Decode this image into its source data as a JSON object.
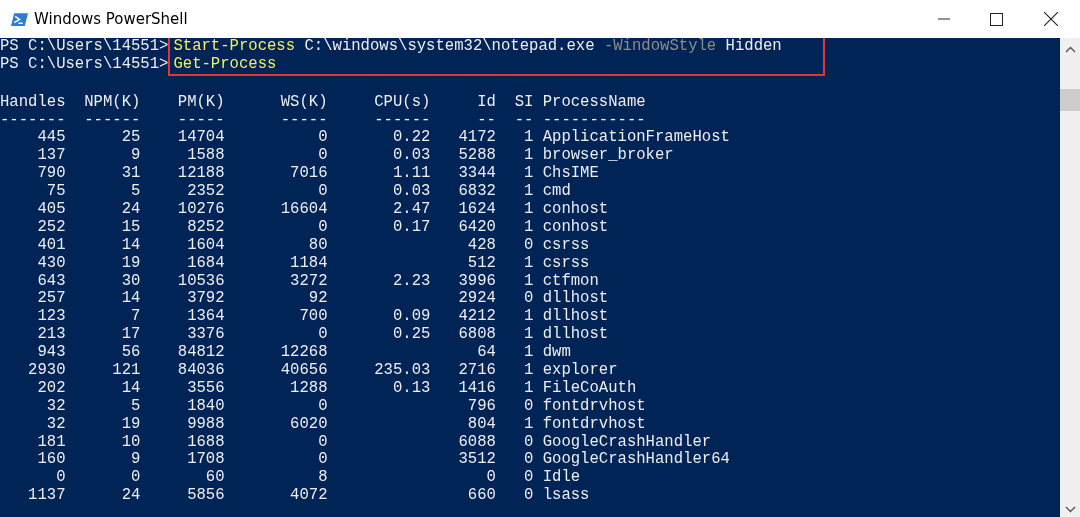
{
  "window": {
    "title": "Windows PowerShell"
  },
  "console": {
    "commands": [
      {
        "prompt": "PS C:\\Users\\14551>",
        "tokens": [
          {
            "kind": "cmdlet",
            "text": "Start-Process"
          },
          {
            "kind": "argument",
            "text": "C:\\windows\\system32\\notepad.exe"
          },
          {
            "kind": "parameter",
            "text": "-WindowStyle"
          },
          {
            "kind": "argument",
            "text": "Hidden"
          }
        ]
      },
      {
        "prompt": "PS C:\\Users\\14551>",
        "tokens": [
          {
            "kind": "cmdlet",
            "text": "Get-Process"
          }
        ]
      }
    ],
    "highlight_box": true,
    "table": {
      "columns": [
        {
          "heading": "Handles",
          "rule": "-------"
        },
        {
          "heading": "NPM(K)",
          "rule": "------"
        },
        {
          "heading": "PM(K)",
          "rule": "-----"
        },
        {
          "heading": "WS(K)",
          "rule": "-----"
        },
        {
          "heading": "CPU(s)",
          "rule": "------"
        },
        {
          "heading": "Id",
          "rule": "--"
        },
        {
          "heading": "SI",
          "rule": "--"
        },
        {
          "heading": "ProcessName",
          "rule": "-----------"
        }
      ],
      "rows": [
        {
          "cells": [
            "445",
            "25",
            "14704",
            "0",
            "0.22",
            "4172",
            "1",
            "ApplicationFrameHost"
          ]
        },
        {
          "cells": [
            "137",
            "9",
            "1588",
            "0",
            "0.03",
            "5288",
            "1",
            "browser_broker"
          ]
        },
        {
          "cells": [
            "790",
            "31",
            "12188",
            "7016",
            "1.11",
            "3344",
            "1",
            "ChsIME"
          ]
        },
        {
          "cells": [
            "75",
            "5",
            "2352",
            "0",
            "0.03",
            "6832",
            "1",
            "cmd"
          ]
        },
        {
          "cells": [
            "405",
            "24",
            "10276",
            "16604",
            "2.47",
            "1624",
            "1",
            "conhost"
          ]
        },
        {
          "cells": [
            "252",
            "15",
            "8252",
            "0",
            "0.17",
            "6420",
            "1",
            "conhost"
          ]
        },
        {
          "cells": [
            "401",
            "14",
            "1604",
            "80",
            null,
            "428",
            "0",
            "csrss"
          ]
        },
        {
          "cells": [
            "430",
            "19",
            "1684",
            "1184",
            null,
            "512",
            "1",
            "csrss"
          ]
        },
        {
          "cells": [
            "643",
            "30",
            "10536",
            "3272",
            "2.23",
            "3996",
            "1",
            "ctfmon"
          ]
        },
        {
          "cells": [
            "257",
            "14",
            "3792",
            "92",
            null,
            "2924",
            "0",
            "dllhost"
          ]
        },
        {
          "cells": [
            "123",
            "7",
            "1364",
            "700",
            "0.09",
            "4212",
            "1",
            "dllhost"
          ]
        },
        {
          "cells": [
            "213",
            "17",
            "3376",
            "0",
            "0.25",
            "6808",
            "1",
            "dllhost"
          ]
        },
        {
          "cells": [
            "943",
            "56",
            "84812",
            "12268",
            null,
            "64",
            "1",
            "dwm"
          ]
        },
        {
          "cells": [
            "2930",
            "121",
            "84036",
            "40656",
            "235.03",
            "2716",
            "1",
            "explorer"
          ]
        },
        {
          "cells": [
            "202",
            "14",
            "3556",
            "1288",
            "0.13",
            "1416",
            "1",
            "FileCoAuth"
          ]
        },
        {
          "cells": [
            "32",
            "5",
            "1840",
            "0",
            null,
            "796",
            "0",
            "fontdrvhost"
          ]
        },
        {
          "cells": [
            "32",
            "19",
            "9988",
            "6020",
            null,
            "804",
            "1",
            "fontdrvhost"
          ]
        },
        {
          "cells": [
            "181",
            "10",
            "1688",
            "0",
            null,
            "6088",
            "0",
            "GoogleCrashHandler"
          ]
        },
        {
          "cells": [
            "160",
            "9",
            "1708",
            "0",
            null,
            "3512",
            "0",
            "GoogleCrashHandler64"
          ]
        },
        {
          "cells": [
            "0",
            "0",
            "60",
            "8",
            null,
            "0",
            "0",
            "Idle"
          ]
        },
        {
          "cells": [
            "1137",
            "24",
            "5856",
            "4072",
            null,
            "660",
            "0",
            "lsass"
          ]
        }
      ]
    }
  }
}
